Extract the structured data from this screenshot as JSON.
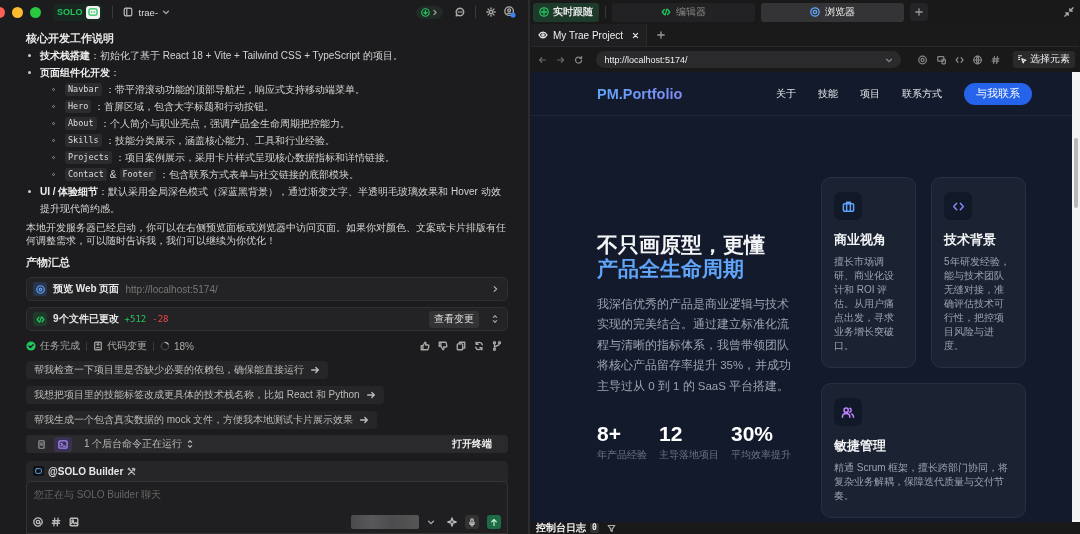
{
  "titlebar": {
    "logo": "SOLO",
    "project": "trae-"
  },
  "chat": {
    "heading": "核心开发工作说明",
    "bullets": [
      {
        "text": "**技术栈搭建**：初始化了基于 React 18 + Vite + Tailwind CSS + TypeScript 的项目。"
      },
      {
        "text": "**页面组件化开发**：",
        "children": [
          {
            "parts": [
              {
                "kind": "code",
                "text": "Navbar"
              },
              {
                "kind": "plain",
                "text": "：带平滑滚动功能的顶部导航栏，响应式支持移动端菜单。"
              }
            ]
          },
          {
            "parts": [
              {
                "kind": "code",
                "text": "Hero"
              },
              {
                "kind": "plain",
                "text": "：首屏区域，包含大字标题和行动按钮。"
              }
            ]
          },
          {
            "parts": [
              {
                "kind": "code",
                "text": "About"
              },
              {
                "kind": "plain",
                "text": "：个人简介与职业亮点，强调产品全生命周期把控能力。"
              }
            ]
          },
          {
            "parts": [
              {
                "kind": "code",
                "text": "Skills"
              },
              {
                "kind": "plain",
                "text": "：技能分类展示，涵盖核心能力、工具和行业经验。"
              }
            ]
          },
          {
            "parts": [
              {
                "kind": "code",
                "text": "Projects"
              },
              {
                "kind": "plain",
                "text": "：项目案例展示，采用卡片样式呈现核心数据指标和详情链接。"
              }
            ]
          },
          {
            "parts": [
              {
                "kind": "code",
                "text": "Contact"
              },
              {
                "kind": "plain",
                "text": "&"
              },
              {
                "kind": "code",
                "text": "Footer"
              },
              {
                "kind": "plain",
                "text": "：包含联系方式表单与社交链接的底部模块。"
              }
            ]
          }
        ]
      },
      {
        "text": "**UI / 体验细节**：默认采用全局深色模式（深蓝黑背景），通过渐变文字、半透明毛玻璃效果和 Hover 动效提升现代简约感。"
      }
    ],
    "paragraph": "本地开发服务器已经启动，你可以在右侧预览面板或浏览器中访问页面。如果你对颜色、文案或卡片排版有任何调整需求，可以随时告诉我，我们可以继续为你优化！",
    "summary_heading": "产物汇总",
    "preview": {
      "label": "预览 Web 页面",
      "url": "http://localhost:5174/"
    },
    "changes": {
      "label": "9个文件已更改",
      "added": "+512",
      "removed": "-28",
      "button": "查看变更"
    },
    "status": [
      {
        "kind": "done",
        "label": "任务完成"
      },
      {
        "kind": "diff",
        "label": "代码变更"
      },
      {
        "kind": "progress",
        "label": "18%"
      }
    ],
    "suggestions": [
      "帮我检查一下项目里是否缺少必要的依赖包，确保能直接运行",
      "我想把项目里的技能标签改成更具体的技术栈名称，比如 React 和 Python",
      "帮我生成一个包含真实数据的 mock 文件，方便我本地测试卡片展示效果"
    ],
    "terminal_bar": {
      "text": "1 个后台命令正在运行",
      "button": "打开终端"
    },
    "composer": {
      "agent": "@SOLO Builder",
      "placeholder": "您正在与 SOLO Builder 聊天"
    }
  },
  "right": {
    "follow": {
      "label": "实时跟随",
      "on": true
    },
    "tabs": [
      {
        "label": "编辑器",
        "kind": "editor",
        "selected": false
      },
      {
        "label": "浏览器",
        "kind": "browser",
        "selected": true
      }
    ],
    "browser_tabs": [
      {
        "label": "My Trae Project",
        "selected": true
      }
    ],
    "address": "http://localhost:5174/",
    "select_button": "选择元素",
    "site": {
      "brand": "PM.Portfolio",
      "nav": [
        "关于",
        "技能",
        "项目",
        "联系方式"
      ],
      "cta": "与我联系",
      "headline": "不只画原型，更懂",
      "headline_accent": "产品全生命周期",
      "intro": "我深信优秀的产品是商业逻辑与技术实现的完美结合。通过建立标准化流程与清晰的指标体系，我曾带领团队将核心产品留存率提升 35%，并成功主导过从 0 到 1 的 SaaS 平台搭建。",
      "stats": [
        {
          "value": "8+",
          "label": "年产品经验"
        },
        {
          "value": "12",
          "label": "主导落地项目"
        },
        {
          "value": "30%",
          "label": "平均效率提升"
        }
      ],
      "cards": [
        {
          "kind": "business",
          "title": "商业视角",
          "text": "擅长市场调研、商业化设计和 ROI 评估。从用户痛点出发，寻求业务增长突破口。"
        },
        {
          "kind": "tech",
          "title": "技术背景",
          "text": "5年研发经验，能与技术团队无缝对接，准确评估技术可行性，把控项目风险与进度。"
        },
        {
          "kind": "team",
          "title": "敏捷管理",
          "text": "精通 Scrum 框架，擅长跨部门协同，将复杂业务解耦，保障迭代质量与交付节奏。"
        }
      ]
    },
    "console": {
      "label": "控制台日志",
      "count": "0"
    }
  }
}
